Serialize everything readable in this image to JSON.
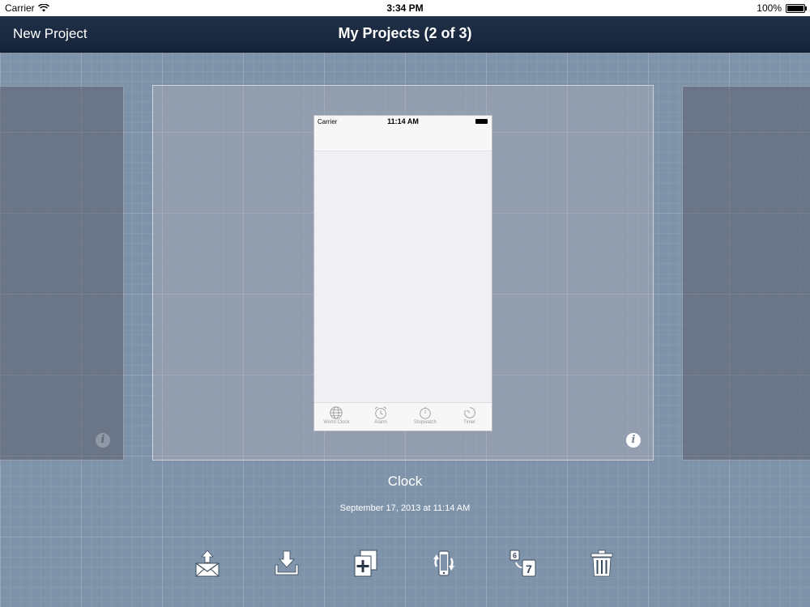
{
  "status_bar": {
    "carrier": "Carrier",
    "time": "3:34 PM",
    "battery": "100%",
    "battery_level": 1.0
  },
  "nav_bar": {
    "new_project_label": "New Project",
    "title": "My Projects (2 of 3)"
  },
  "preview": {
    "carrier": "Carrier",
    "time": "11:14 AM",
    "tabs": [
      {
        "label": "World Clock",
        "icon": "globe-icon"
      },
      {
        "label": "Alarm",
        "icon": "alarm-clock-icon"
      },
      {
        "label": "Stopwatch",
        "icon": "stopwatch-icon"
      },
      {
        "label": "Timer",
        "icon": "timer-icon"
      }
    ]
  },
  "project": {
    "name": "Clock",
    "date": "September 17, 2013 at 11:14 AM"
  },
  "toolbar": {
    "items": [
      {
        "name": "email-export",
        "icon": "envelope-upload-icon"
      },
      {
        "name": "import",
        "icon": "tray-download-icon"
      },
      {
        "name": "duplicate",
        "icon": "duplicate-plus-icon"
      },
      {
        "name": "rotate-device",
        "icon": "phone-rotate-icon"
      },
      {
        "name": "convert-ios7",
        "icon": "convert-ios7-icon"
      },
      {
        "name": "delete",
        "icon": "trash-icon"
      }
    ]
  },
  "colors": {
    "background": "#7e93a9",
    "navbar": "#1a2a40",
    "text_light": "#ffffff"
  }
}
